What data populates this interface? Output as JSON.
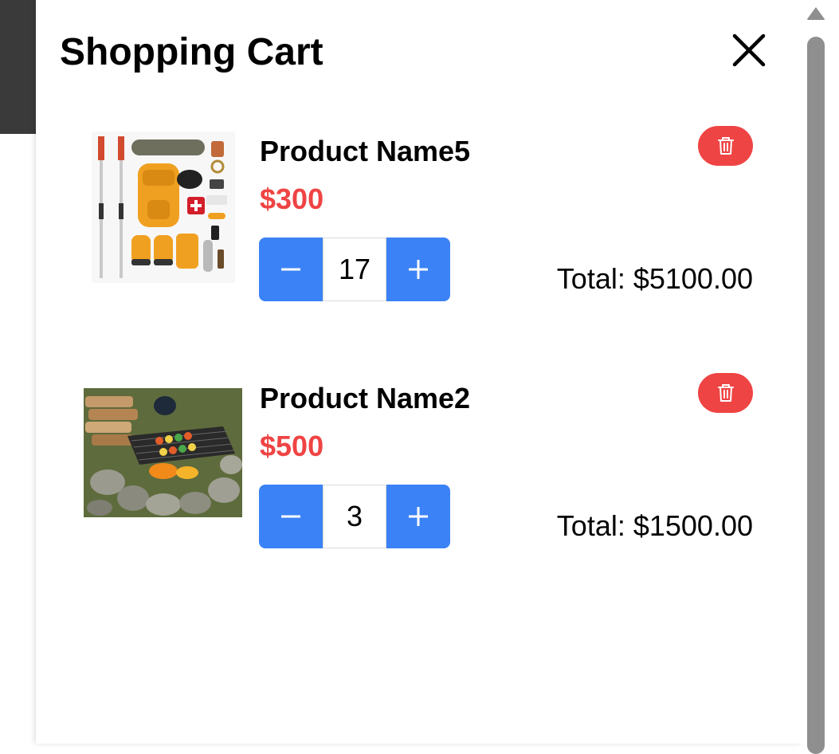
{
  "cart": {
    "title": "Shopping Cart",
    "items": [
      {
        "name": "Product Name5",
        "price": "$300",
        "quantity": "17",
        "total": "Total: $5100.00",
        "image": "backpack-gear-flatlay"
      },
      {
        "name": "Product Name2",
        "price": "$500",
        "quantity": "3",
        "total": "Total: $1500.00",
        "image": "campfire-grill"
      }
    ]
  },
  "icons": {
    "close": "close-icon",
    "decrement": "minus-icon",
    "increment": "plus-icon",
    "delete": "trash-icon",
    "scroll_up": "scroll-up-arrow-icon"
  },
  "colors": {
    "accent_blue": "#3b82f6",
    "price_red": "#ef4444",
    "delete_red": "#ef4444",
    "scrollbar_thumb": "#8f8f8f",
    "backdrop": "#3a3a3a"
  }
}
